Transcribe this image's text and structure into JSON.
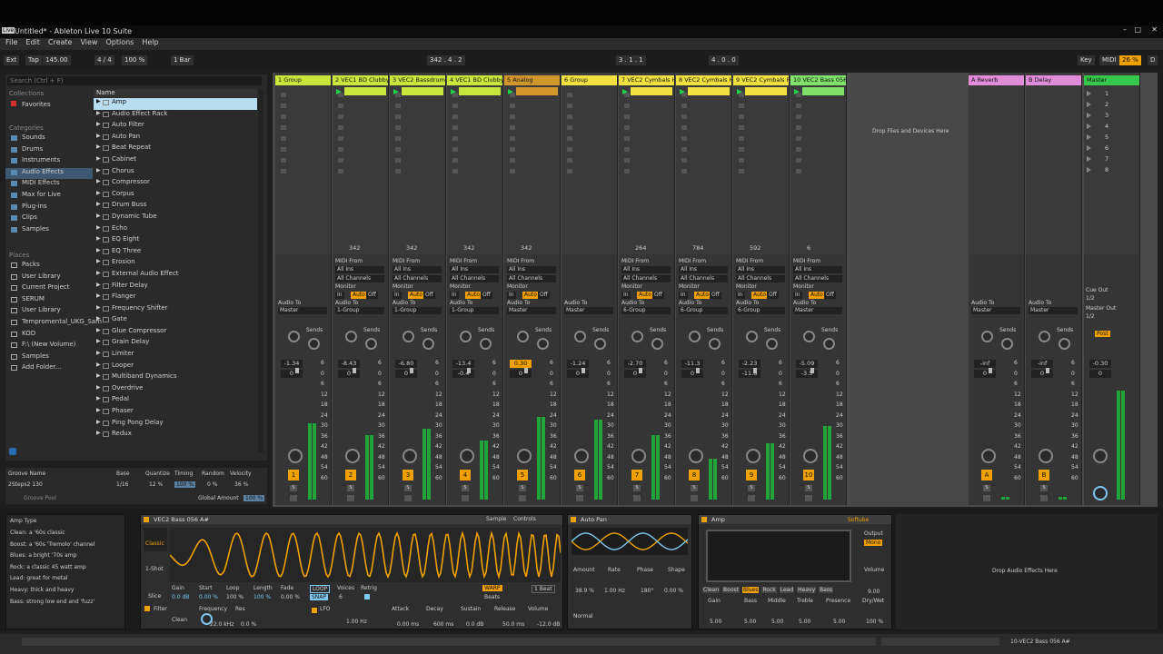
{
  "window_title": "Untitled* - Ableton Live 10 Suite",
  "menu": [
    "File",
    "Edit",
    "Create",
    "View",
    "Options",
    "Help"
  ],
  "control": {
    "ext": "Ext",
    "tap": "Tap",
    "tempo": "145.00",
    "sig": "4 / 4",
    "zoom": "100 %",
    "quant": "1 Bar",
    "pos": "342 . 4 . 2",
    "loop_start": "3 . 1 . 1",
    "loop_len": "4 . 0 . 0",
    "key": "Key",
    "midi": "MIDI",
    "cpu": "26 %",
    "d": "D"
  },
  "browser": {
    "search": "Search (Ctrl + F)",
    "collections_label": "Collections",
    "favorites": "Favorites",
    "categories_label": "Categories",
    "categories": [
      "Sounds",
      "Drums",
      "Instruments",
      "Audio Effects",
      "MIDI Effects",
      "Max for Live",
      "Plug-ins",
      "Clips",
      "Samples"
    ],
    "places_label": "Places",
    "places": [
      "Packs",
      "User Library",
      "Current Project",
      "SERUM",
      "User Library",
      "Tempromental_UKG_Sam",
      "KOD",
      "F:\\ (New Volume)",
      "Samples",
      "Add Folder..."
    ],
    "name_header": "Name",
    "items": [
      "Amp",
      "Audio Effect Rack",
      "Auto Filter",
      "Auto Pan",
      "Beat Repeat",
      "Cabinet",
      "Chorus",
      "Compressor",
      "Corpus",
      "Drum Buss",
      "Dynamic Tube",
      "Echo",
      "EQ Eight",
      "EQ Three",
      "Erosion",
      "External Audio Effect",
      "Filter Delay",
      "Flanger",
      "Frequency Shifter",
      "Gate",
      "Glue Compressor",
      "Grain Delay",
      "Limiter",
      "Looper",
      "Multiband Dynamics",
      "Overdrive",
      "Pedal",
      "Phaser",
      "Ping Pong Delay",
      "Redux"
    ]
  },
  "groove": {
    "h_name": "Groove Name",
    "h_base": "Base",
    "h_quant": "Quantize",
    "h_timing": "Timing",
    "h_random": "Random",
    "h_velocity": "Velocity",
    "name": "2Steps2 130",
    "base": "1/16",
    "quant": "12 %",
    "timing": "100 %",
    "random": "0 %",
    "velocity": "36 %",
    "pool": "Groove Pool",
    "global_label": "Global Amount",
    "global": "100 %"
  },
  "tracks": [
    {
      "name": "1 Group",
      "color": "#c8e63c",
      "vol": "-1.34",
      "pan": "0",
      "num": "1",
      "route": "Master",
      "midi": false,
      "clip": ""
    },
    {
      "name": "2 VEC1 BD Clubby",
      "color": "#c8e63c",
      "vol": "-8.43",
      "pan": "0",
      "num": "2",
      "route": "1-Group",
      "midi": true,
      "clip": "342"
    },
    {
      "name": "3 VEC2 Bassdrums",
      "color": "#c8e63c",
      "vol": "-6.80",
      "pan": "0",
      "num": "3",
      "route": "1-Group",
      "midi": true,
      "clip": "342"
    },
    {
      "name": "4 VEC1 BD Clubby",
      "color": "#c8e63c",
      "vol": "-13.4",
      "pan": "-0.4",
      "num": "4",
      "route": "1-Group",
      "midi": true,
      "clip": "342"
    },
    {
      "name": "5 Analog",
      "color": "#d0962c",
      "vol": "0.30",
      "pan": "0",
      "num": "5",
      "route": "Master",
      "midi": true,
      "clip": "342"
    },
    {
      "name": "6 Group",
      "color": "#f0e040",
      "vol": "-1.24",
      "pan": "0",
      "num": "6",
      "route": "Master",
      "midi": false,
      "clip": ""
    },
    {
      "name": "7 VEC2 Cymbals H",
      "color": "#f0e040",
      "vol": "-2.70",
      "pan": "0",
      "num": "7",
      "route": "6-Group",
      "midi": true,
      "clip": "264"
    },
    {
      "name": "8 VEC2 Cymbals H",
      "color": "#f0e040",
      "vol": "-11.3",
      "pan": "0",
      "num": "8",
      "route": "6-Group",
      "midi": true,
      "clip": "784"
    },
    {
      "name": "9 VEC2 Cymbals Ri",
      "color": "#f0e040",
      "vol": "-2.23",
      "pan": "-11.8",
      "num": "9",
      "route": "6-Group",
      "midi": true,
      "clip": "592"
    },
    {
      "name": "10 VEC2 Bass 056",
      "color": "#7fe06a",
      "vol": "-5.09",
      "pan": "-3.5",
      "num": "10",
      "route": "Master",
      "midi": true,
      "clip": "6"
    }
  ],
  "returns": [
    {
      "name": "A Reverb",
      "color": "#e08cd8",
      "vol": "-inf",
      "pan": "0",
      "num": "A",
      "route": "Master"
    },
    {
      "name": "B Delay",
      "color": "#e08cd8",
      "vol": "-inf",
      "pan": "0",
      "num": "B",
      "route": "Master"
    }
  ],
  "master": {
    "name": "Master",
    "color": "#35c84a",
    "vol": "-0.30",
    "pan": "0",
    "scenes": [
      "1",
      "2",
      "3",
      "4",
      "5",
      "6",
      "7",
      "8"
    ],
    "cue": "Cue Out",
    "cue_val": "1/2",
    "mout": "Master Out",
    "mout_val": "1/2",
    "post": "Post"
  },
  "mixer_labels": {
    "midi_from": "MIDI From",
    "all_ins": "All Ins",
    "all_ch": "All Channels",
    "monitor": "Monitor",
    "in": "In",
    "auto": "Auto",
    "off": "Off",
    "audio_to": "Audio To",
    "sends": "Sends",
    "drop": "Drop Files and Devices Here"
  },
  "info": {
    "title": "Amp Type",
    "lines": [
      "Clean: a '60s classic",
      "Boost: a '60s 'Tremolo' channel",
      "Blues: a bright '70s amp",
      "Rock: a classic 45 watt amp",
      "Lead: great for metal",
      "Heavy: thick and heavy",
      "Bass: strong low end and 'fuzz'"
    ]
  },
  "simpler": {
    "title": "VEC2 Bass 056 A#",
    "tab_sample": "Sample",
    "tab_controls": "Controls",
    "classic": "Classic",
    "oneshot": "1-Shot",
    "slice": "Slice",
    "gain": "0.0 dB",
    "start": "0.00 %",
    "loop": "100 %",
    "length": "100 %",
    "fade": "0.00 %",
    "warp": "WARP",
    "beat": "1 Beat",
    "filter": "Filter",
    "freq": "22.0 kHz",
    "res": "0.0 %",
    "lfo": "LFO",
    "hz": "1.00 Hz",
    "attack": "0.00 ms",
    "decay": "600 ms",
    "sustain": "0.0 dB",
    "release": "50.0 ms",
    "volume": "-12.0 dB",
    "l_freq": "Frequency",
    "l_res": "Res",
    "l_att": "Attack",
    "l_dec": "Decay",
    "l_sus": "Sustain",
    "l_rel": "Release",
    "l_vol": "Volume",
    "clean": "Clean",
    "voices": "Voices",
    "retrig": "Retrig",
    "vnum": "6",
    "l_gain": "Gain",
    "l_start": "Start",
    "l_loop": "Loop",
    "l_length": "Length",
    "l_fade": "Fade",
    "loopbtn": "LOOP",
    "snap": "SNAP",
    "beats": "Beats"
  },
  "autopan": {
    "title": "Auto Pan",
    "amount": "38.9 %",
    "rate": "1.00 Hz",
    "phase": "180°",
    "shape": "0.00 %",
    "normal": "Normal",
    "l_amount": "Amount",
    "l_rate": "Rate",
    "l_phase": "Phase",
    "l_shape": "Shape"
  },
  "amp": {
    "title": "Amp",
    "brand": "Softube",
    "types": [
      "Clean",
      "Boost",
      "Blues",
      "Rock",
      "Lead",
      "Heavy",
      "Bass"
    ],
    "gain": "5.00",
    "bass": "5.00",
    "middle": "5.00",
    "treble": "5.00",
    "presence": "5.00",
    "volume": "9.00",
    "drywet": "100 %",
    "output": "Output",
    "mono": "Mono",
    "l_gain": "Gain",
    "l_bass": "Bass",
    "l_middle": "Middle",
    "l_treble": "Treble",
    "l_presence": "Presence",
    "l_volume": "Volume",
    "l_drywet": "Dry/Wet"
  },
  "drop_fx": "Drop Audio Effects Here",
  "status": "10-VEC2 Bass 056 A#"
}
